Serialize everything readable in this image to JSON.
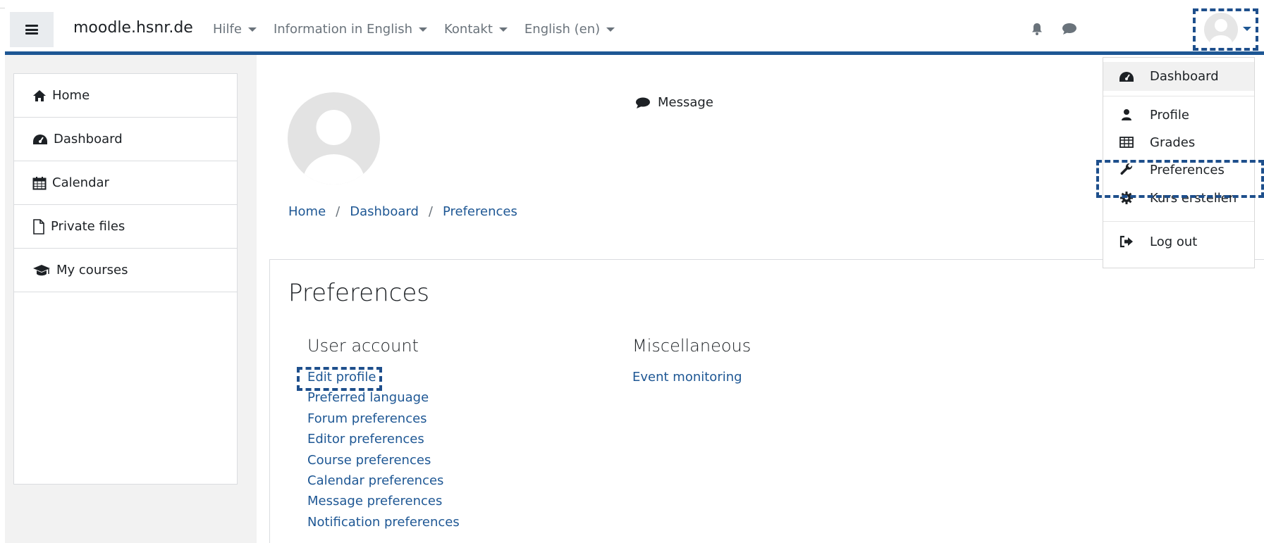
{
  "brand": "moodle.hsnr.de",
  "nav_menu": [
    {
      "label": "Hilfe"
    },
    {
      "label": "Information in English"
    },
    {
      "label": "Kontakt"
    },
    {
      "label": "English (en)"
    }
  ],
  "sidebar": {
    "items": [
      {
        "label": "Home",
        "icon": "home-icon"
      },
      {
        "label": "Dashboard",
        "icon": "dashboard-icon"
      },
      {
        "label": "Calendar",
        "icon": "calendar-icon"
      },
      {
        "label": "Private files",
        "icon": "file-icon"
      },
      {
        "label": "My courses",
        "icon": "graduation-cap-icon"
      }
    ]
  },
  "profile_header": {
    "message_label": "Message"
  },
  "breadcrumb": [
    {
      "label": "Home"
    },
    {
      "label": "Dashboard"
    },
    {
      "label": "Preferences"
    }
  ],
  "page": {
    "title": "Preferences",
    "user_account": {
      "title": "User account",
      "links": [
        "Edit profile",
        "Preferred language",
        "Forum preferences",
        "Editor preferences",
        "Course preferences",
        "Calendar preferences",
        "Message preferences",
        "Notification preferences"
      ]
    },
    "misc": {
      "title": "Miscellaneous",
      "links": [
        "Event monitoring"
      ]
    }
  },
  "user_menu": {
    "items": [
      {
        "label": "Dashboard",
        "icon": "dashboard-icon"
      },
      {
        "label": "Profile",
        "icon": "user-icon"
      },
      {
        "label": "Grades",
        "icon": "table-icon"
      },
      {
        "label": "Preferences",
        "icon": "wrench-icon"
      },
      {
        "label": "Kurs erstellen",
        "icon": "cog-icon"
      },
      {
        "label": "Log out",
        "icon": "sign-out-icon"
      }
    ]
  },
  "colors": {
    "accent": "#1e5794",
    "link": "#1e5794",
    "highlight_dash": "#1e4f8c"
  }
}
